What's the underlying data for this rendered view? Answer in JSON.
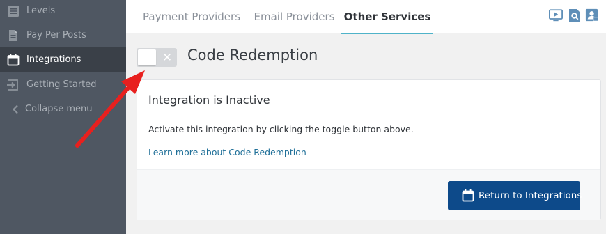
{
  "sidebar": {
    "items": [
      {
        "label": "Levels",
        "icon": "list-icon"
      },
      {
        "label": "Pay Per Posts",
        "icon": "document-icon"
      },
      {
        "label": "Integrations",
        "icon": "calendar-icon",
        "active": true
      },
      {
        "label": "Getting Started",
        "icon": "sign-in-icon"
      },
      {
        "label": "Collapse menu",
        "icon": "chevron-left-icon"
      }
    ]
  },
  "tabs": [
    {
      "label": "Payment Providers"
    },
    {
      "label": "Email Providers"
    },
    {
      "label": "Other Services",
      "active": true
    }
  ],
  "toolbar_icons": [
    "video-tutorial-icon",
    "search-doc-icon",
    "user-email-icon"
  ],
  "page": {
    "title": "Code Redemption",
    "toggle_state": "off"
  },
  "card": {
    "heading": "Integration is Inactive",
    "description": "Activate this integration by clicking the toggle button above.",
    "link": "Learn more about Code Redemption",
    "return_button": "Return to Integrations"
  },
  "colors": {
    "sidebar_bg": "#4f5762",
    "sidebar_active_bg": "#3a4048",
    "tab_active_underline": "#4fb3c9",
    "primary_button": "#0d4a8a",
    "link": "#1f6f98",
    "toolbar_icon": "#5f8fb8",
    "annotation_arrow": "#e8201e"
  }
}
